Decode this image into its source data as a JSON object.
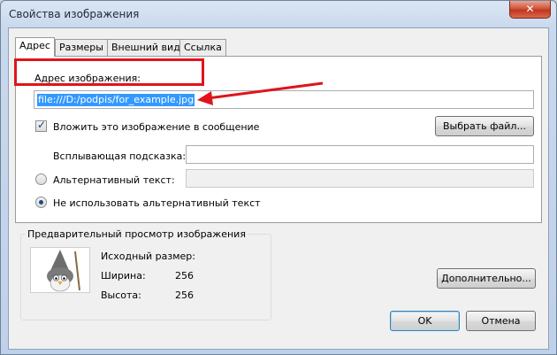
{
  "window": {
    "title": "Свойства изображения",
    "close_glyph": "✕"
  },
  "tabs": [
    {
      "label": "Адрес",
      "active": true
    },
    {
      "label": "Размеры",
      "active": false
    },
    {
      "label": "Внешний вид",
      "active": false
    },
    {
      "label": "Ссылка",
      "active": false
    }
  ],
  "location": {
    "label": "Адрес изображения:",
    "url": "file:///D:/podpis/for_example.jpg",
    "attach_checkbox": {
      "label": "Вложить это изображение в сообщение",
      "checked": true
    },
    "choose_file_button": "Выбрать файл...",
    "tooltip_label": "Всплывающая подсказка:",
    "tooltip_value": "",
    "alt_radio_label": "Альтернативный текст:",
    "alt_value": "",
    "no_alt_radio_label": "Не использовать альтернативный текст",
    "selected_radio": "no_alt"
  },
  "preview": {
    "title": "Предварительный просмотр изображения",
    "original_size_label": "Исходный размер:",
    "width_label": "Ширина:",
    "width_value": "256",
    "height_label": "Высота:",
    "height_value": "256"
  },
  "buttons": {
    "advanced": "Дополнительно...",
    "ok": "OK",
    "cancel": "Отмена"
  },
  "colors": {
    "annotation": "#e0141b",
    "selection": "#3399ff"
  }
}
